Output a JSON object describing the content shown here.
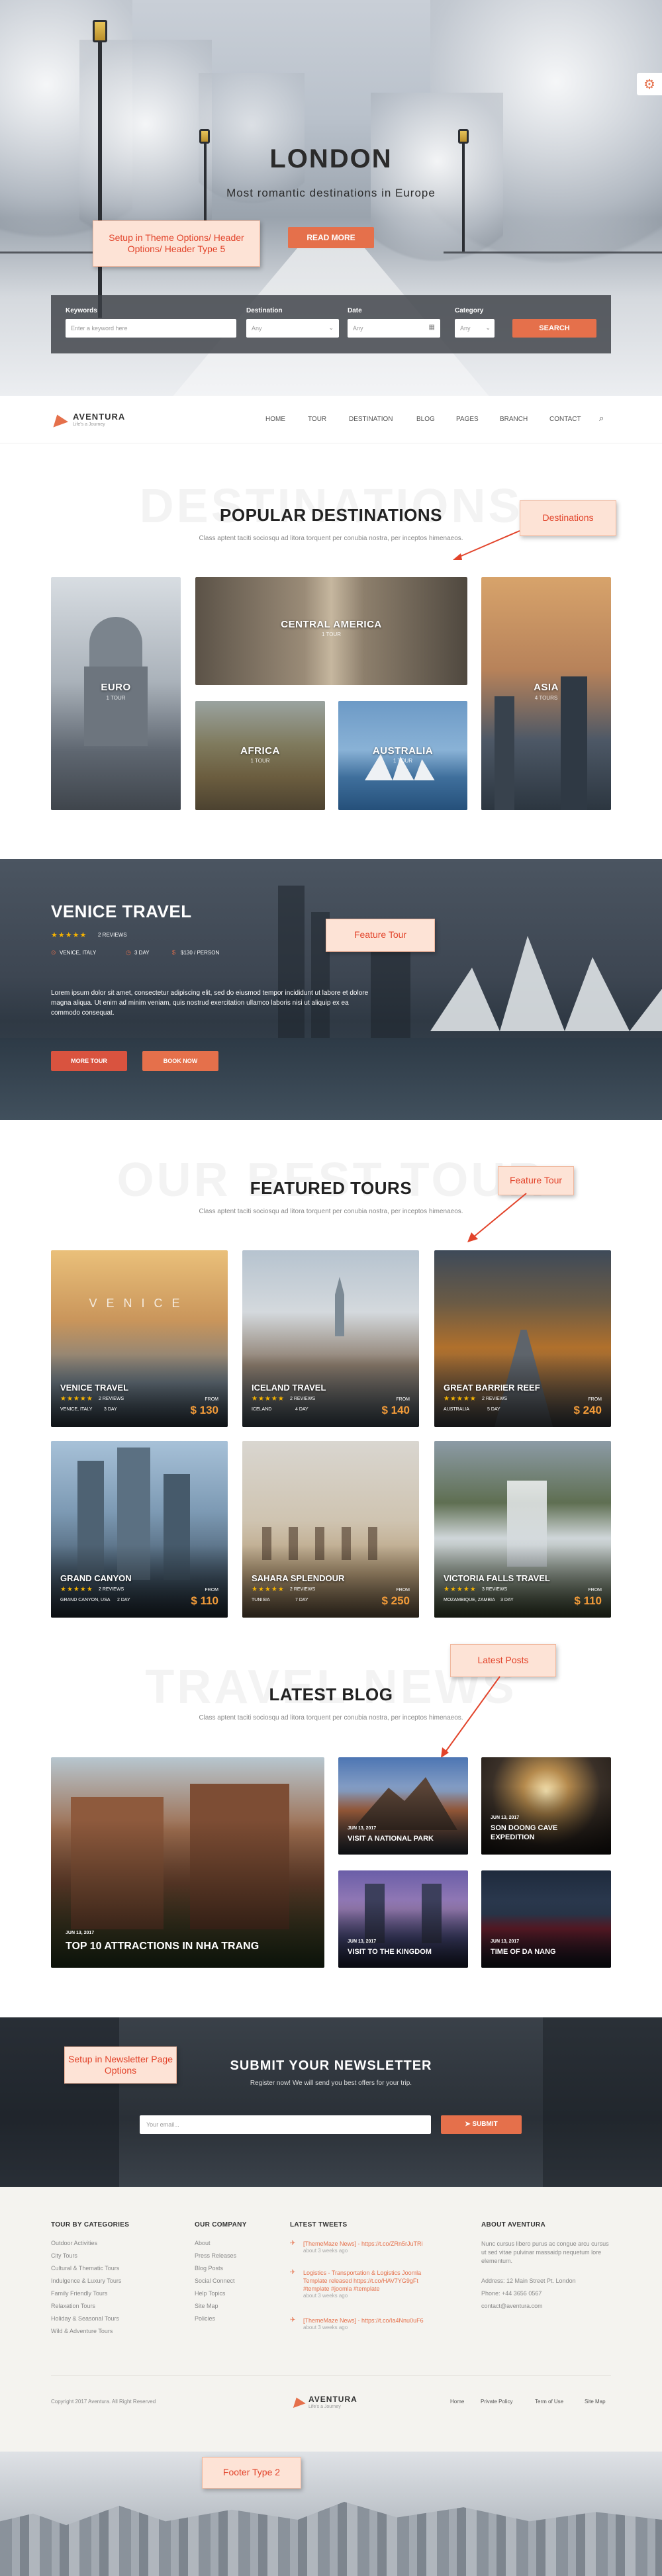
{
  "hero": {
    "title": "LONDON",
    "subtitle": "Most romantic destinations in Europe",
    "read_more": "READ MORE",
    "note": "Setup in Theme Options/ Header Options/ Header Type 5"
  },
  "search": {
    "keywords_label": "Keywords",
    "keywords_placeholder": "Enter a keyword here",
    "destination_label": "Destination",
    "destination_value": "Any",
    "date_label": "Date",
    "date_placeholder": "Any",
    "category_label": "Category",
    "category_value": "Any",
    "search_button": "SEARCH"
  },
  "nav": {
    "logo_name": "AVENTURA",
    "logo_tagline": "Life's a Journey",
    "items": [
      "HOME",
      "TOUR",
      "DESTINATION",
      "BLOG",
      "PAGES",
      "BRANCH",
      "CONTACT"
    ]
  },
  "destinations": {
    "ghost": "DESTINATIONS",
    "title": "POPULAR DESTINATIONS",
    "subtitle": "Class aptent taciti sociosqu ad litora torquent per conubia nostra, per inceptos himenaeos.",
    "note": "Destinations",
    "cards": [
      {
        "name": "EURO",
        "count": "1 TOUR"
      },
      {
        "name": "CENTRAL AMERICA",
        "count": "1 TOUR"
      },
      {
        "name": "ASIA",
        "count": "4 TOURS"
      },
      {
        "name": "AFRICA",
        "count": "1 TOUR"
      },
      {
        "name": "AUSTRALIA",
        "count": "1 TOUR"
      }
    ]
  },
  "feature": {
    "title": "VENICE TRAVEL",
    "reviews": "2 REVIEWS",
    "location": "VENICE, ITALY",
    "duration": "3 DAY",
    "price": "$130 / PERSON",
    "description": "Lorem ipsum dolor sit amet, consectetur adipiscing elit, sed do eiusmod tempor incididunt ut labore et dolore magna aliqua. Ut enim ad minim veniam, quis nostrud exercitation ullamco laboris nisi ut aliquip ex ea commodo consequat.",
    "more_button": "MORE TOUR",
    "book_button": "BOOK NOW",
    "note": "Feature Tour"
  },
  "tours": {
    "ghost": "OUR BEST TOUR",
    "title": "FEATURED TOURS",
    "subtitle": "Class aptent taciti sociosqu ad litora torquent per conubia nostra, per inceptos himenaeos.",
    "note": "Feature Tour",
    "from_label": "FROM",
    "items": [
      {
        "name": "VENICE TRAVEL",
        "stars": "★★★★★",
        "reviews": "2 REVIEWS",
        "place": "VENICE, ITALY",
        "days": "3 DAY",
        "price": "$ 130"
      },
      {
        "name": "ICELAND TRAVEL",
        "stars": "★★★★★",
        "reviews": "2 REVIEWS",
        "place": "ICELAND",
        "days": "4 DAY",
        "price": "$ 140"
      },
      {
        "name": "GREAT BARRIER REEF",
        "stars": "★★★★★",
        "reviews": "2 REVIEWS",
        "place": "AUSTRALIA",
        "days": "5 DAY",
        "price": "$ 240"
      },
      {
        "name": "GRAND CANYON",
        "stars": "★★★★★",
        "reviews": "2 REVIEWS",
        "place": "GRAND CANYON, USA",
        "days": "2 DAY",
        "price": "$ 110"
      },
      {
        "name": "SAHARA SPLENDOUR",
        "stars": "★★★★★",
        "reviews": "2 REVIEWS",
        "place": "TUNISIA",
        "days": "7 DAY",
        "price": "$ 250"
      },
      {
        "name": "VICTORIA FALLS TRAVEL",
        "stars": "★★★★★",
        "reviews": "3 REVIEWS",
        "place": "MOZAMBIQUE, ZAMBIA",
        "days": "3 DAY",
        "price": "$ 110"
      }
    ]
  },
  "blog": {
    "ghost": "TRAVEL NEWS",
    "title": "LATEST BLOG",
    "subtitle": "Class aptent taciti sociosqu ad litora torquent per conubia nostra, per inceptos himenaeos.",
    "note": "Latest Posts",
    "posts": [
      {
        "date": "JUN 13, 2017",
        "title": "TOP 10 ATTRACTIONS IN NHA TRANG"
      },
      {
        "date": "JUN 13, 2017",
        "title": "VISIT A NATIONAL PARK"
      },
      {
        "date": "JUN 13, 2017",
        "title": "SON DOONG CAVE EXPEDITION"
      },
      {
        "date": "JUN 13, 2017",
        "title": "VISIT TO THE KINGDOM"
      },
      {
        "date": "JUN 13, 2017",
        "title": "TIME OF DA NANG"
      }
    ]
  },
  "newsletter": {
    "title": "SUBMIT YOUR NEWSLETTER",
    "subtitle": "Register now! We will send you best offers for your trip.",
    "placeholder": "Your email...",
    "button": "SUBMIT",
    "note": "Setup in Newsletter Page Options"
  },
  "footer": {
    "col1_title": "TOUR BY CATEGORIES",
    "col1_links": [
      "Outdoor Activities",
      "City Tours",
      "Cultural & Thematic Tours",
      "Indulgence & Luxury Tours",
      "Family Friendly Tours",
      "Relaxation Tours",
      "Holiday & Seasonal Tours",
      "Wild & Adventure Tours"
    ],
    "col2_title": "OUR COMPANY",
    "col2_links": [
      "About",
      "Press Releases",
      "Blog Posts",
      "Social Connect",
      "Help Topics",
      "Site Map",
      "Policies"
    ],
    "col3_title": "LATEST TWEETS",
    "tweets": [
      {
        "text": "[ThemeMaze News] - https://t.co/ZRn5rJuTRi",
        "time": "about 3 weeks ago"
      },
      {
        "text": "Logistics - Transportation & Logistics Joomla Template released https://t.co/HAV7YG9gFt #template #joomla #template",
        "time": "about 3 weeks ago"
      },
      {
        "text": "[ThemeMaze News] - https://t.co/Ia4Nnu0uF6",
        "time": "about 3 weeks ago"
      }
    ],
    "col4_title": "ABOUT AVENTURA",
    "about_text": "Nunc cursus libero purus ac congue arcu cursus ut sed vitae pulvinar massaidp nequetum lore elementum.",
    "address": "Address: 12 Main Street Pt. London",
    "phone": "Phone: +44 3656 0567",
    "email": "contact@aventura.com",
    "copyright": "Copyright 2017 Aventura. All Right Reserved",
    "bottom_links": [
      "Home",
      "Private Policy",
      "Term of Use",
      "Site Map"
    ],
    "note": "Footer Type 2"
  },
  "colors": {
    "accent": "#e5704b",
    "price": "#f29b39",
    "note_text": "#e2432a",
    "star": "#f5b301"
  },
  "icons": [
    "gear-icon",
    "search-icon",
    "calendar-icon",
    "chevron-down-icon",
    "paper-plane-icon",
    "twitter-icon",
    "location-icon",
    "clock-icon",
    "dollar-icon"
  ]
}
